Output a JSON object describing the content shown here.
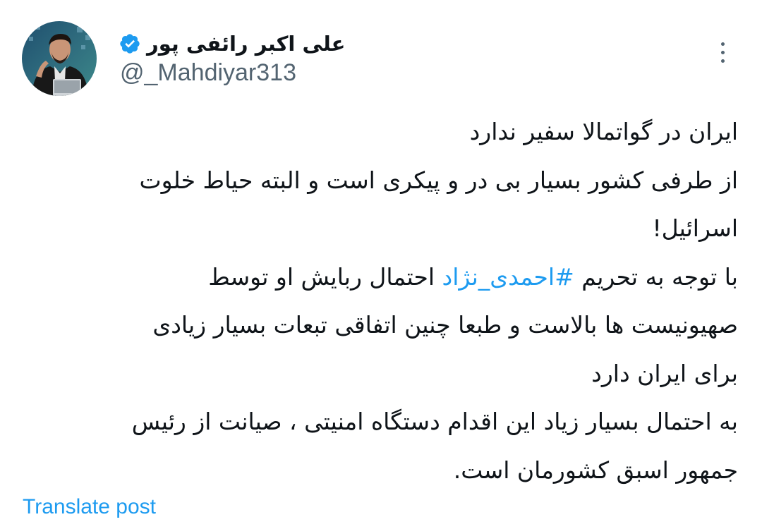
{
  "author": {
    "display_name": "علی اکبر رائفی پور",
    "handle": "@_Mahdiyar313",
    "verified": true,
    "avatar_icon": "profile-photo"
  },
  "more_icon": "three-dots-vertical-icon",
  "tweet": {
    "line_1": "ایران در گواتمالا سفیر ندارد",
    "line_2": "از طرفی کشور بسیار بی در و پیکری است و البته حیاط خلوت",
    "line_3": "اسرائیل!",
    "line_4_before": "با توجه به تحریم ",
    "hashtag": "#احمدی_نژاد",
    "line_4_after": " احتمال ربایش او توسط",
    "line_5": "صهیونیست ها بالاست و طبعا چنین اتفاقی تبعات بسیار زیادی",
    "line_6": "برای ایران دارد",
    "line_7": "به احتمال بسیار زیاد این اقدام دستگاه امنیتی ، صیانت از رئیس",
    "line_8": "جمهور اسبق کشورمان است."
  },
  "translate_label": "Translate post",
  "colors": {
    "text": "#0f1419",
    "secondary": "#536471",
    "link": "#1d9bf0",
    "verified_badge": "#1d9bf0"
  }
}
